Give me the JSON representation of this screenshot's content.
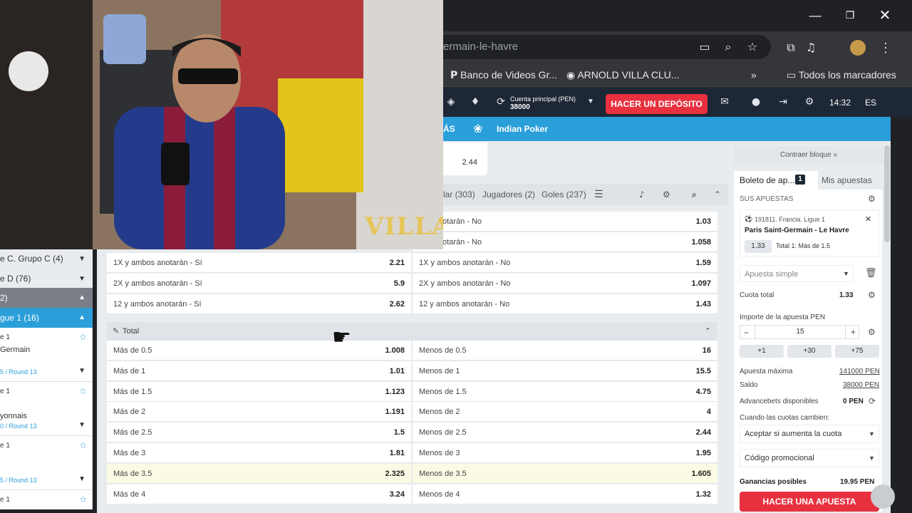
{
  "browser": {
    "url_text": "ermain-le-havre",
    "bookmarks": [
      "Banco de Videos Gr...",
      "ARNOLD VILLA CLU...",
      "Todos los marcadores"
    ]
  },
  "site_header": {
    "account_label": "Cuenta principal (PEN)",
    "balance": "38000",
    "deposit_button": "HACER UN DEPÓSITO",
    "time": "14:32",
    "language": "ES"
  },
  "nav": {
    "more": "ÁS",
    "indian_poker": "Indian Poker"
  },
  "prev_odd": "2.44",
  "tabs": [
    "lar (303)",
    "Jugadores (2)",
    "Goles (237)"
  ],
  "btts_rows": [
    {
      "left_label": "",
      "left_odd": "",
      "right_label": "bos anotarán - No",
      "right_odd": "1.03"
    },
    {
      "left_label": "",
      "left_odd": "",
      "right_label": "bos anotarán - No",
      "right_odd": "1.058"
    },
    {
      "left_label": "1X y ambos anotarán - Sí",
      "left_odd": "2.21",
      "right_label": "1X y ambos anotarán - No",
      "right_odd": "1.59"
    },
    {
      "left_label": "2X y ambos anotarán - Sí",
      "left_odd": "5.9",
      "right_label": "2X y ambos anotarán - No",
      "right_odd": "1.097"
    },
    {
      "left_label": "12 y ambos anotarán - Sí",
      "left_odd": "2.62",
      "right_label": "12 y ambos anotarán - No",
      "right_odd": "1.43"
    }
  ],
  "total_market": {
    "title": "Total",
    "rows": [
      {
        "over": "Más de 0.5",
        "over_odd": "1.008",
        "under": "Menos de 0.5",
        "under_odd": "16"
      },
      {
        "over": "Más de 1",
        "over_odd": "1.01",
        "under": "Menos de 1",
        "under_odd": "15.5"
      },
      {
        "over": "Más de 1.5",
        "over_odd": "1.123",
        "under": "Menos de 1.5",
        "under_odd": "4.75"
      },
      {
        "over": "Más de 2",
        "over_odd": "1.191",
        "under": "Menos de 2",
        "under_odd": "4"
      },
      {
        "over": "Más de 2.5",
        "over_odd": "1.5",
        "under": "Menos de 2.5",
        "under_odd": "2.44"
      },
      {
        "over": "Más de 3",
        "over_odd": "1.81",
        "under": "Menos de 3",
        "under_odd": "1.95"
      },
      {
        "over": "Más de 3.5",
        "over_odd": "2.325",
        "under": "Menos de 3.5",
        "under_odd": "1.605"
      },
      {
        "over": "Más de 4",
        "over_odd": "3.24",
        "under": "Menos de 4",
        "under_odd": "1.32"
      }
    ]
  },
  "slip": {
    "collapse_block": "Contraer bloque »",
    "tab_ticket": "Boleto de ap...",
    "ticket_count": "1",
    "tab_my_bets": "Mis apuestas",
    "your_bets": "SUS APUESTAS",
    "event_id": "191811. Francia. Ligue 1",
    "match": "Paris Saint-Germain - Le Havre",
    "selection_odd": "1.33",
    "selection": "Total 1: Más de 1.5",
    "bet_type": "Apuesta simple",
    "total_odds_label": "Cuota total",
    "total_odds": "1.33",
    "stake_label": "Importe de la apuesta PEN",
    "stake": "15",
    "quick": [
      "+1",
      "+30",
      "+75"
    ],
    "max_bet_label": "Apuesta máxima",
    "max_bet": "141000 PEN",
    "balance_label": "Saldo",
    "balance": "38000 PEN",
    "advancebets_label": "Advancebets disponibles",
    "advancebets": "0 PEN",
    "odds_change_label": "Cuando las cuotas cambien:",
    "odds_change_option": "Aceptar si aumenta la cuota",
    "promo_label": "Código promocional",
    "possible_win_label": "Ganancias posibles",
    "possible_win": "19.95 PEN",
    "place_bet_button": "HACER UNA APUESTA"
  },
  "sidebar": {
    "rows": [
      "e C. Grupo C (4)",
      "e D (76)",
      "2)",
      "gue 1 (16)"
    ],
    "matches": [
      {
        "league": "e 1",
        "team": "Germain",
        "round": "5 / Round 13"
      },
      {
        "league": "e 1",
        "team": "yonnais",
        "round": "0 / Round 13"
      },
      {
        "league": "e 1",
        "team": "",
        "round": "5 / Round 13"
      },
      {
        "league": "e 1",
        "team": "",
        "round": ""
      }
    ]
  },
  "overlay": {
    "watermark": "VILLA"
  },
  "colors": {
    "accent_blue": "#2b9fd9",
    "deposit_red": "#e8313f",
    "header_dark": "#1d2735"
  }
}
